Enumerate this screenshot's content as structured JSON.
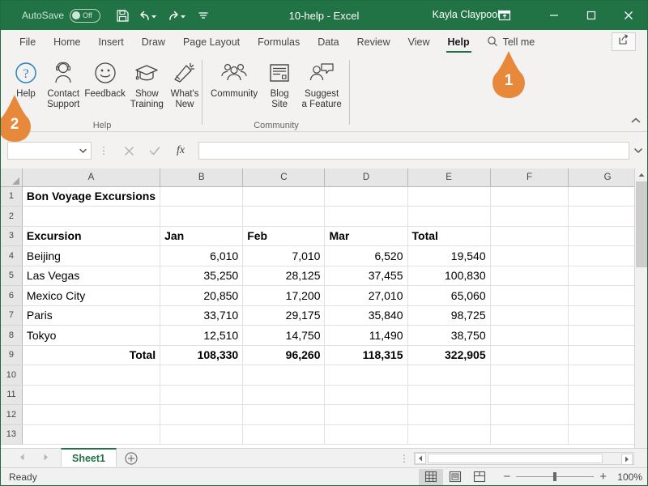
{
  "titlebar": {
    "autosave_label": "AutoSave",
    "autosave_state": "Off",
    "document_title": "10-help  -  Excel",
    "user_name": "Kayla Claypool",
    "qat": [
      {
        "name": "save-icon",
        "label": "Save"
      },
      {
        "name": "undo-icon",
        "label": "Undo"
      },
      {
        "name": "redo-icon",
        "label": "Redo"
      },
      {
        "name": "customize-qat-icon",
        "label": "Customize Quick Access Toolbar"
      }
    ],
    "window_buttons": [
      {
        "name": "ribbon-display-options-icon",
        "label": "Ribbon Display Options"
      },
      {
        "name": "minimize-icon",
        "label": "Minimize"
      },
      {
        "name": "maximize-icon",
        "label": "Maximize"
      },
      {
        "name": "close-icon",
        "label": "Close"
      }
    ]
  },
  "ribbon": {
    "tabs": [
      {
        "label": "File",
        "active": false
      },
      {
        "label": "Home",
        "active": false
      },
      {
        "label": "Insert",
        "active": false
      },
      {
        "label": "Draw",
        "active": false
      },
      {
        "label": "Page Layout",
        "active": false
      },
      {
        "label": "Formulas",
        "active": false
      },
      {
        "label": "Data",
        "active": false
      },
      {
        "label": "Review",
        "active": false
      },
      {
        "label": "View",
        "active": false
      },
      {
        "label": "Help",
        "active": true
      }
    ],
    "tell_me": "Tell me",
    "share_label": "Share",
    "groups": [
      {
        "name": "Help",
        "items": [
          {
            "label": "Help",
            "icon": "question-circle-icon"
          },
          {
            "label": "Contact\nSupport",
            "label_line1": "Contact",
            "label_line2": "Support",
            "icon": "headset-person-icon"
          },
          {
            "label": "Feedback",
            "label_line1": "Feedback",
            "label_line2": "",
            "icon": "smiley-face-icon"
          },
          {
            "label": "Show\nTraining",
            "label_line1": "Show",
            "label_line2": "Training",
            "icon": "graduation-cap-icon"
          },
          {
            "label": "What's\nNew",
            "label_line1": "What's",
            "label_line2": "New",
            "icon": "megaphone-icon"
          }
        ]
      },
      {
        "name": "Community",
        "items": [
          {
            "label": "Community",
            "label_line1": "Community",
            "label_line2": "",
            "icon": "people-group-icon"
          },
          {
            "label": "Blog\nSite",
            "label_line1": "Blog",
            "label_line2": "Site",
            "icon": "blog-page-icon"
          },
          {
            "label": "Suggest\na Feature",
            "label_line1": "Suggest",
            "label_line2": "a Feature",
            "icon": "person-speech-bubble-icon"
          }
        ]
      }
    ]
  },
  "formula_bar": {
    "name_box_value": "",
    "formula_value": "",
    "cancel_label": "Cancel",
    "enter_label": "Enter",
    "fx_label": "fx"
  },
  "grid": {
    "columns": [
      "A",
      "B",
      "C",
      "D",
      "E",
      "F",
      "G"
    ],
    "rows": [
      {
        "num": "1",
        "cells": [
          {
            "v": "Bon Voyage Excursions",
            "align": "left",
            "bold": true
          },
          {
            "v": ""
          },
          {
            "v": ""
          },
          {
            "v": ""
          },
          {
            "v": ""
          },
          {
            "v": ""
          },
          {
            "v": ""
          }
        ]
      },
      {
        "num": "2",
        "cells": [
          {
            "v": ""
          },
          {
            "v": ""
          },
          {
            "v": ""
          },
          {
            "v": ""
          },
          {
            "v": ""
          },
          {
            "v": ""
          },
          {
            "v": ""
          }
        ]
      },
      {
        "num": "3",
        "cells": [
          {
            "v": "Excursion",
            "align": "left",
            "bold": true
          },
          {
            "v": "Jan",
            "align": "left",
            "bold": true
          },
          {
            "v": "Feb",
            "align": "left",
            "bold": true
          },
          {
            "v": "Mar",
            "align": "left",
            "bold": true
          },
          {
            "v": "Total",
            "align": "left",
            "bold": true
          },
          {
            "v": ""
          },
          {
            "v": ""
          }
        ]
      },
      {
        "num": "4",
        "cells": [
          {
            "v": "Beijing",
            "align": "left"
          },
          {
            "v": "6,010",
            "align": "right"
          },
          {
            "v": "7,010",
            "align": "right"
          },
          {
            "v": "6,520",
            "align": "right"
          },
          {
            "v": "19,540",
            "align": "right"
          },
          {
            "v": ""
          },
          {
            "v": ""
          }
        ]
      },
      {
        "num": "5",
        "cells": [
          {
            "v": "Las Vegas",
            "align": "left"
          },
          {
            "v": "35,250",
            "align": "right"
          },
          {
            "v": "28,125",
            "align": "right"
          },
          {
            "v": "37,455",
            "align": "right"
          },
          {
            "v": "100,830",
            "align": "right"
          },
          {
            "v": ""
          },
          {
            "v": ""
          }
        ]
      },
      {
        "num": "6",
        "cells": [
          {
            "v": "Mexico City",
            "align": "left"
          },
          {
            "v": "20,850",
            "align": "right"
          },
          {
            "v": "17,200",
            "align": "right"
          },
          {
            "v": "27,010",
            "align": "right"
          },
          {
            "v": "65,060",
            "align": "right"
          },
          {
            "v": ""
          },
          {
            "v": ""
          }
        ]
      },
      {
        "num": "7",
        "cells": [
          {
            "v": "Paris",
            "align": "left"
          },
          {
            "v": "33,710",
            "align": "right"
          },
          {
            "v": "29,175",
            "align": "right"
          },
          {
            "v": "35,840",
            "align": "right"
          },
          {
            "v": "98,725",
            "align": "right"
          },
          {
            "v": ""
          },
          {
            "v": ""
          }
        ]
      },
      {
        "num": "8",
        "cells": [
          {
            "v": "Tokyo",
            "align": "left"
          },
          {
            "v": "12,510",
            "align": "right"
          },
          {
            "v": "14,750",
            "align": "right"
          },
          {
            "v": "11,490",
            "align": "right"
          },
          {
            "v": "38,750",
            "align": "right"
          },
          {
            "v": ""
          },
          {
            "v": ""
          }
        ]
      },
      {
        "num": "9",
        "cells": [
          {
            "v": "Total",
            "align": "right",
            "bold": true
          },
          {
            "v": "108,330",
            "align": "right",
            "bold": true
          },
          {
            "v": "96,260",
            "align": "right",
            "bold": true
          },
          {
            "v": "118,315",
            "align": "right",
            "bold": true
          },
          {
            "v": "322,905",
            "align": "right",
            "bold": true
          },
          {
            "v": ""
          },
          {
            "v": ""
          }
        ]
      },
      {
        "num": "10",
        "cells": [
          {
            "v": ""
          },
          {
            "v": ""
          },
          {
            "v": ""
          },
          {
            "v": ""
          },
          {
            "v": ""
          },
          {
            "v": ""
          },
          {
            "v": ""
          }
        ]
      },
      {
        "num": "11",
        "cells": [
          {
            "v": ""
          },
          {
            "v": ""
          },
          {
            "v": ""
          },
          {
            "v": ""
          },
          {
            "v": ""
          },
          {
            "v": ""
          },
          {
            "v": ""
          }
        ]
      },
      {
        "num": "12",
        "cells": [
          {
            "v": ""
          },
          {
            "v": ""
          },
          {
            "v": ""
          },
          {
            "v": ""
          },
          {
            "v": ""
          },
          {
            "v": ""
          },
          {
            "v": ""
          }
        ]
      },
      {
        "num": "13",
        "cells": [
          {
            "v": ""
          },
          {
            "v": ""
          },
          {
            "v": ""
          },
          {
            "v": ""
          },
          {
            "v": ""
          },
          {
            "v": ""
          },
          {
            "v": ""
          }
        ]
      }
    ]
  },
  "sheet_tabs": {
    "tabs": [
      {
        "label": "Sheet1",
        "active": true
      }
    ],
    "add_sheet_label": "New sheet"
  },
  "status_bar": {
    "status_text": "Ready",
    "view_buttons": [
      {
        "name": "normal-view-icon",
        "label": "Normal",
        "active": true
      },
      {
        "name": "page-layout-view-icon",
        "label": "Page Layout",
        "active": false
      },
      {
        "name": "page-break-preview-icon",
        "label": "Page Break Preview",
        "active": false
      }
    ],
    "zoom_out_label": "−",
    "zoom_in_label": "+",
    "zoom_level": "100%"
  },
  "callouts": [
    {
      "number": "1",
      "target": "help-tab"
    },
    {
      "number": "2",
      "target": "help-button"
    }
  ],
  "colors": {
    "brand_green": "#217346",
    "callout_orange": "#e8883a",
    "ribbon_bg": "#f3f2f1"
  }
}
